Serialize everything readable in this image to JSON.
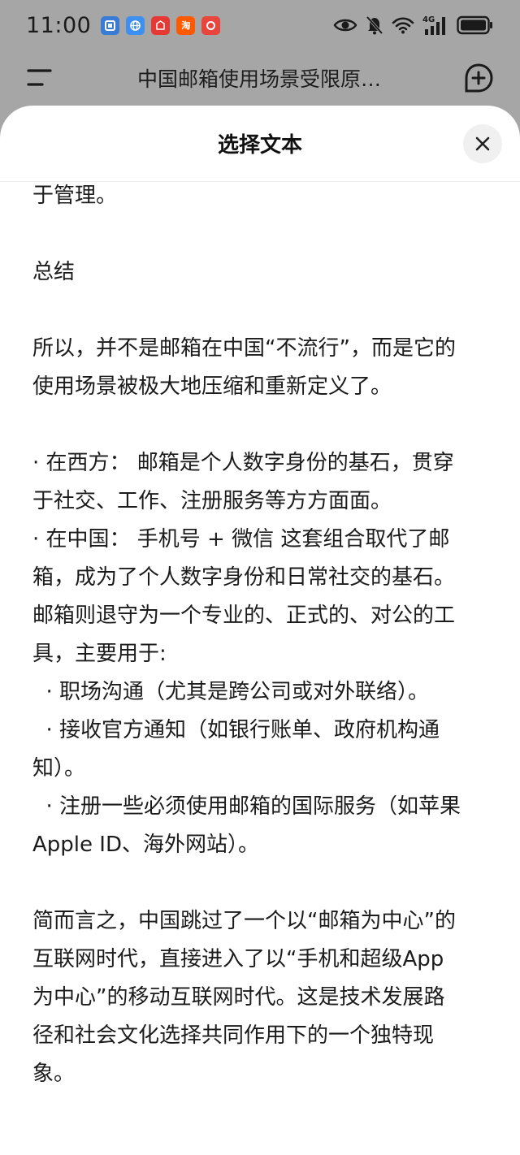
{
  "status_bar": {
    "time": "11:00",
    "apps": [
      {
        "icon": "blue-app-icon",
        "label": "",
        "color": "#3a7bd5"
      },
      {
        "icon": "globe-app-icon",
        "label": "",
        "color": "#3d8ff0"
      },
      {
        "icon": "red-app-icon",
        "label": "",
        "color": "#e53935"
      },
      {
        "icon": "taobao-icon",
        "label": "淘",
        "color": "#ff5a00"
      },
      {
        "icon": "chess-app-icon",
        "label": "",
        "color": "#e8453c"
      }
    ],
    "network": "4G"
  },
  "app_bar": {
    "title": "中国邮箱使用场景受限原…"
  },
  "sheet": {
    "title": "选择文本",
    "paragraphs": [
      [
        "于管理。"
      ],
      [
        "总结"
      ],
      [
        "所以，并不是邮箱在中国“不流行”，而是它的",
        "使用场景被极大地压缩和重新定义了。"
      ],
      [
        "· 在西方： 邮箱是个人数字身份的基石，贯穿",
        "于社交、工作、注册服务等方方面面。",
        "· 在中国： 手机号 + 微信 这套组合取代了邮",
        "箱，成为了个人数字身份和日常社交的基石。",
        "邮箱则退守为一个专业的、正式的、对公的工",
        "具，主要用于:",
        "  · 职场沟通（尤其是跨公司或对外联络）。",
        "  · 接收官方通知（如银行账单、政府机构通",
        "知）。",
        "  · 注册一些必须使用邮箱的国际服务（如苹果",
        "Apple ID、海外网站）。"
      ],
      [
        "简而言之，中国跳过了一个以“邮箱为中心”的",
        "互联网时代，直接进入了以“手机和超级App",
        "为中心”的移动互联网时代。这是技术发展路",
        "径和社会文化选择共同作用下的一个独特现",
        "象。"
      ]
    ]
  },
  "colors": {
    "dim_background": "#a6a6a6",
    "sheet_background": "#ffffff",
    "text": "#1b1b1b"
  }
}
